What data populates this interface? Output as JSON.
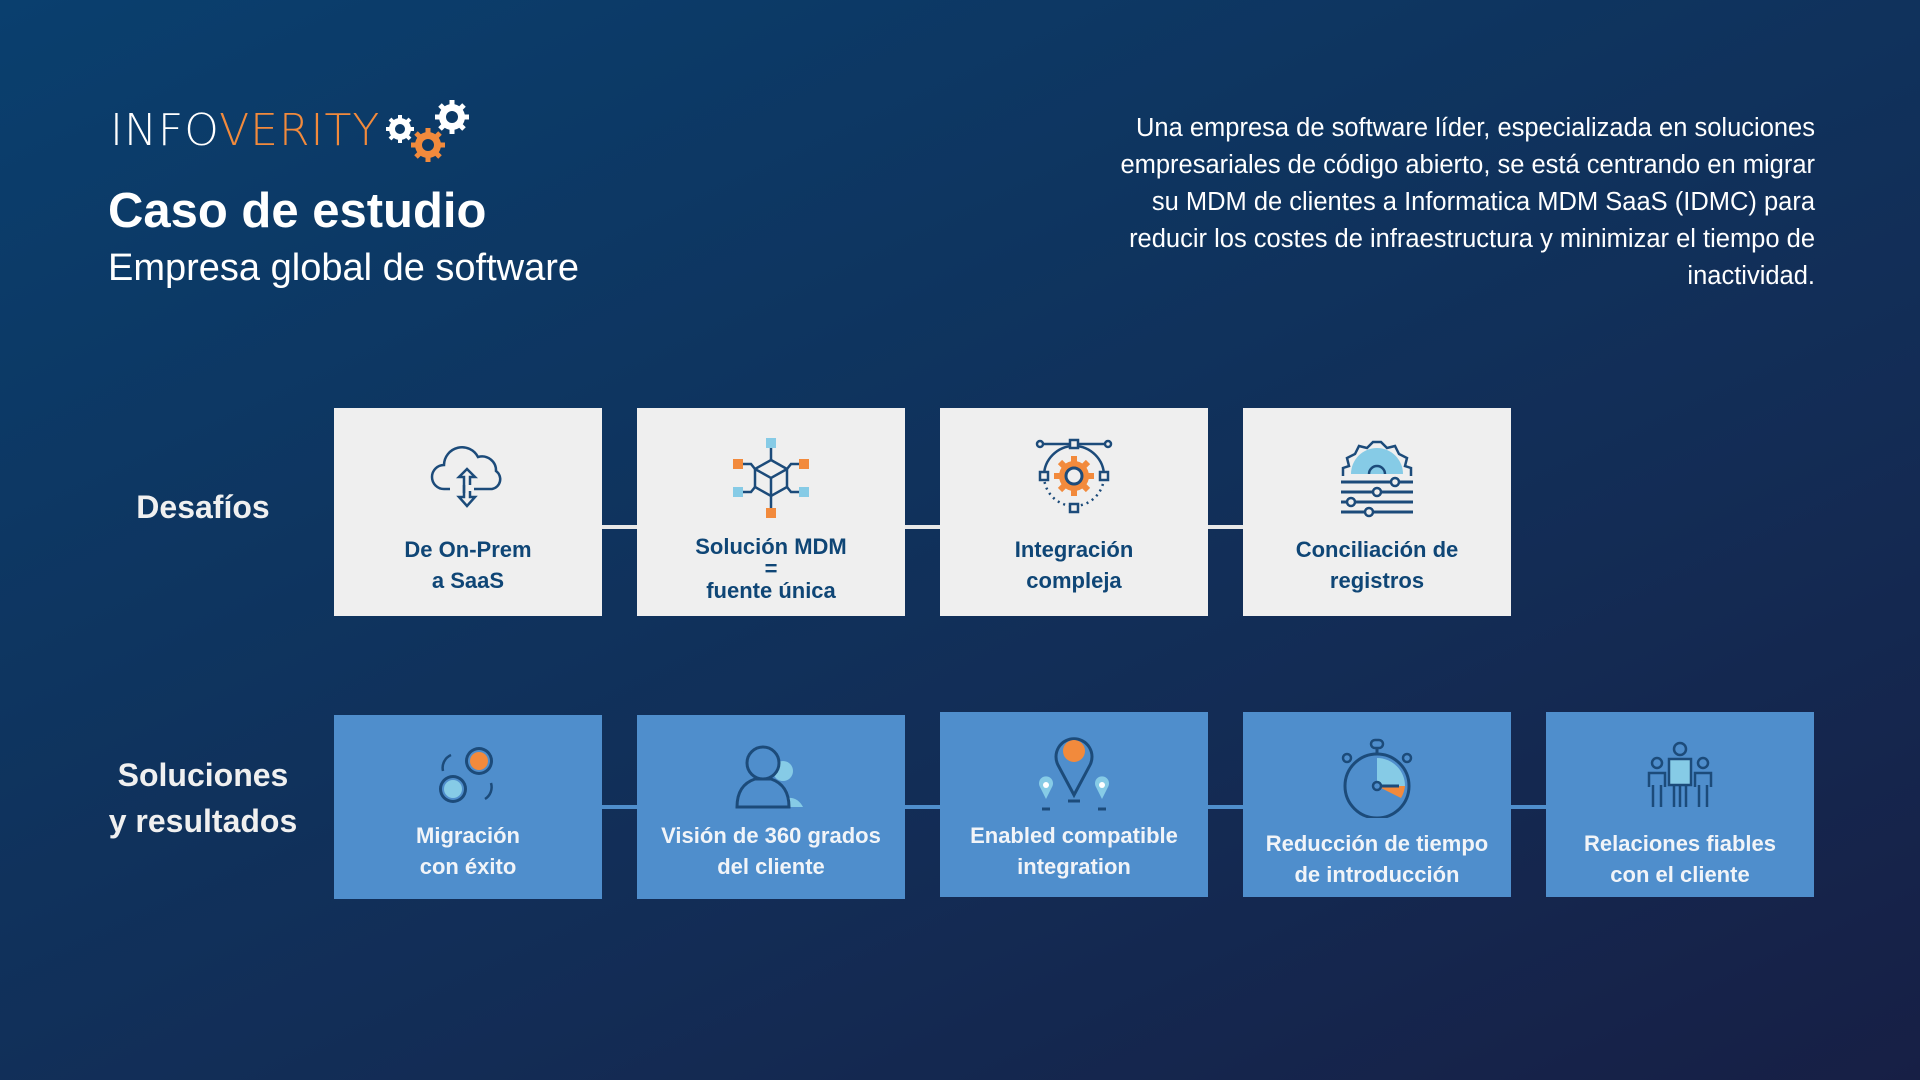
{
  "logo": {
    "part1": "INFO",
    "part2": "VERITY",
    "icon": "gears-icon"
  },
  "header": {
    "title": "Caso de estudio",
    "subtitle": "Empresa global de software",
    "intro": "Una empresa de software líder, especializada en soluciones empresariales de código abierto, se está centrando en migrar su MDM de clientes a Informatica MDM SaaS (IDMC) para reducir los costes de infraestructura y minimizar el tiempo de inactividad."
  },
  "challenges": {
    "label": "Desafíos",
    "items": [
      {
        "label": "De On-Prem\na SaaS",
        "icon": "cloud-sync-icon"
      },
      {
        "label": "Solución MDM\n=\nfuente única",
        "icon": "network-cube-icon"
      },
      {
        "label": "Integración\ncompleja",
        "icon": "gear-bezier-icon"
      },
      {
        "label": "Conciliación de\nregistros",
        "icon": "gear-sliders-icon"
      }
    ]
  },
  "solutions": {
    "label": "Soluciones\ny resultados",
    "items": [
      {
        "label": "Migración\ncon éxito",
        "icon": "migration-circles-icon"
      },
      {
        "label": "Visión de 360 grados\ndel cliente",
        "icon": "customer-profile-icon"
      },
      {
        "label": "Enabled compatible\nintegration",
        "icon": "location-pins-icon"
      },
      {
        "label": "Reducción de tiempo\nde introducción",
        "icon": "stopwatch-icon"
      },
      {
        "label": "Relaciones fiables\ncon el cliente",
        "icon": "team-icon"
      }
    ]
  },
  "colors": {
    "orange": "#f28a3c",
    "dark_blue": "#0f4676",
    "light_blue": "#86cbe6",
    "solution_box": "#4f8ecc",
    "challenge_box": "#efefef"
  }
}
